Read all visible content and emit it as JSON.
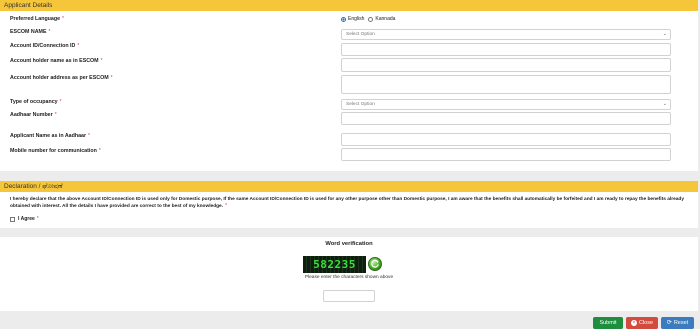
{
  "applicant": {
    "header": "Applicant Details",
    "fields": {
      "preferred_language": {
        "label": "Preferred Language",
        "req": "*"
      },
      "lang_english": "English",
      "lang_kannada": "Kannada",
      "escom_name": {
        "label": "ESCOM NAME",
        "req": "*",
        "value": "Select Option"
      },
      "account_id": {
        "label": "Account ID/Connection ID",
        "req": "*"
      },
      "holder_name": {
        "label": "Account holder name as in ESCOM",
        "req": "*"
      },
      "holder_address": {
        "label": "Account holder address as per ESCOM",
        "req": "*"
      },
      "occupancy": {
        "label": "Type of occupancy",
        "req": "*",
        "value": "Select Option"
      },
      "aadhaar_number": {
        "label": "Aadhaar Number",
        "req": "*"
      },
      "aadhaar_name": {
        "label": "Applicant Name as in Aadhaar",
        "req": "*"
      },
      "mobile": {
        "label": "Mobile number for communication",
        "req": "*"
      }
    }
  },
  "declaration": {
    "header": "Declaration / ಘೋಷಣೆ",
    "text": "I hereby declare that the above Account ID/Connection ID is used only for Domestic purpose, If the same Account ID/Connection ID is used for any other purpose other than Domestic purpose, I am aware that the benefits shall automatically be forfeited and I am ready to repay the benefits already obtained with interest. All the details I have provided are correct to the best of my knowledge.",
    "text_req": "*",
    "agree_label": "I Agree",
    "agree_req": "*"
  },
  "verification": {
    "title": "Word verification",
    "captcha": "582235",
    "hint": "Please enter the characters shown above"
  },
  "actions": {
    "submit": "Submit",
    "close": "Close",
    "reset": "Reset"
  },
  "colors": {
    "header_bg": "#f5c53a",
    "submit": "#1e8e3e",
    "close": "#d24b3e",
    "reset": "#3c7bbd"
  }
}
